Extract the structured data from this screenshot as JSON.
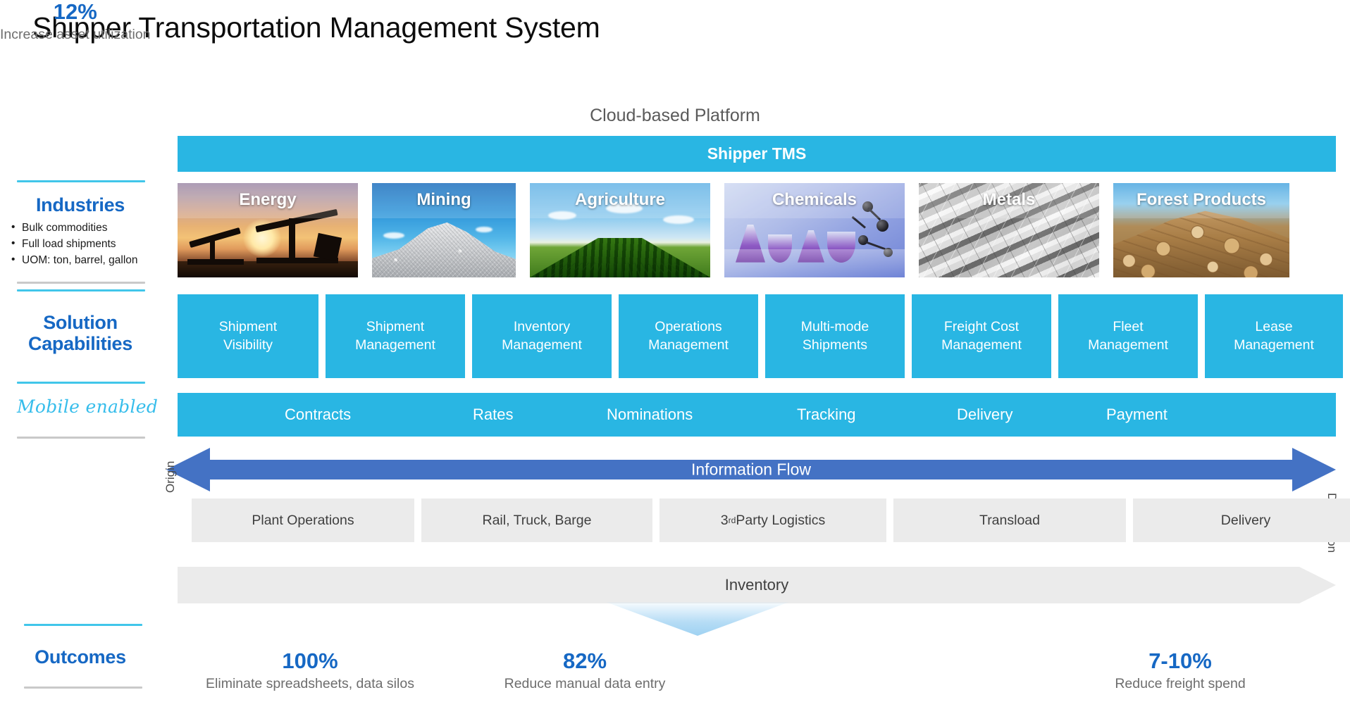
{
  "page_title": "Shipper Transportation Management System",
  "cloud_caption": "Cloud-based Platform",
  "platform_bar": {
    "label": "Shipper TMS"
  },
  "rail": {
    "industries": {
      "heading": "Industries",
      "bullets": [
        "Bulk commodities",
        "Full load shipments",
        "UOM: ton, barrel, gallon"
      ]
    },
    "solution": {
      "heading_line1": "Solution",
      "heading_line2": "Capabilities"
    },
    "mobile": {
      "label": "Mobile enabled"
    },
    "outcomes": {
      "heading": "Outcomes"
    }
  },
  "industries": [
    {
      "label": "Energy",
      "art": "energy"
    },
    {
      "label": "Mining",
      "art": "mining"
    },
    {
      "label": "Agriculture",
      "art": "agriculture"
    },
    {
      "label": "Chemicals",
      "art": "chemicals"
    },
    {
      "label": "Metals",
      "art": "metals"
    },
    {
      "label": "Forest Products",
      "art": "forest"
    }
  ],
  "capabilities": [
    {
      "line1": "Shipment",
      "line2": "Visibility"
    },
    {
      "line1": "Shipment",
      "line2": "Management"
    },
    {
      "line1": "Inventory",
      "line2": "Management"
    },
    {
      "line1": "Operations",
      "line2": "Management"
    },
    {
      "line1": "Multi-mode",
      "line2": "Shipments"
    },
    {
      "line1": "Freight Cost",
      "line2": "Management"
    },
    {
      "line1": "Fleet",
      "line2": "Management"
    },
    {
      "line1": "Lease",
      "line2": "Management"
    }
  ],
  "process_steps": [
    "Contracts",
    "Rates",
    "Nominations",
    "Tracking",
    "Delivery",
    "Payment"
  ],
  "information_flow": {
    "label": "Information Flow",
    "color": "#4472c4",
    "direction": "bidirectional"
  },
  "supply_chain": {
    "origin_label": "Origin",
    "destination_label": "Destination",
    "stages": [
      "Plant Operations",
      "Rail, Truck, Barge",
      "3rd Party Logistics",
      "Transload",
      "Delivery"
    ],
    "third_party_prefix": "3",
    "third_party_sup": "rd",
    "third_party_rest": " Party Logistics"
  },
  "inventory": {
    "label": "Inventory"
  },
  "outcomes": [
    {
      "value": "100%",
      "desc": "Eliminate spreadsheets, data silos"
    },
    {
      "value": "82%",
      "desc": "Reduce manual data entry"
    },
    {
      "value": "12%",
      "desc": "Increase asset utilization"
    },
    {
      "value": "7-10%",
      "desc": "Reduce freight spend"
    }
  ],
  "colors": {
    "brand_cyan": "#29b6e3",
    "accent_blue": "#1668c4",
    "flow_blue": "#4472c4",
    "stage_grey": "#ebebeb",
    "script_cyan": "#36bdeb"
  }
}
